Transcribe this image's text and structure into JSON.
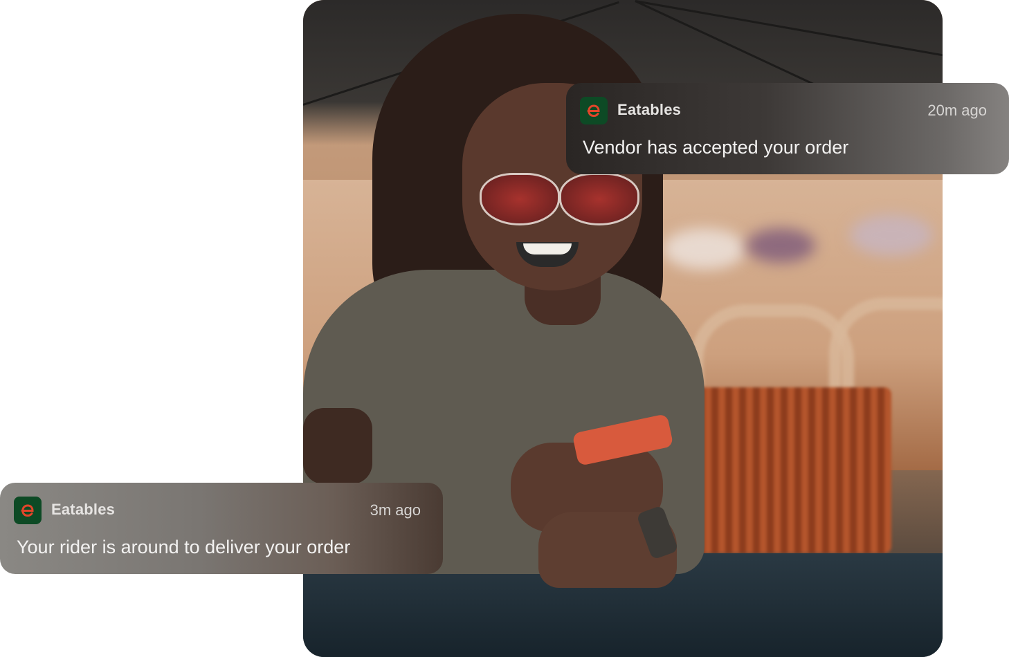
{
  "notifications": [
    {
      "app": "Eatables",
      "time": "20m ago",
      "message": "Vendor has accepted your order",
      "icon": "eatables-logo-icon"
    },
    {
      "app": "Eatables",
      "time": "3m ago",
      "message": "Your rider is around to deliver your order",
      "icon": "eatables-logo-icon"
    }
  ],
  "colors": {
    "icon_bg": "#0d4a25",
    "icon_glyph": "#e2452a"
  }
}
